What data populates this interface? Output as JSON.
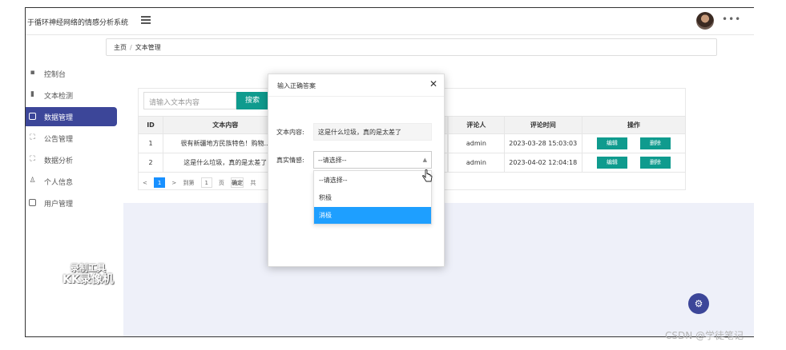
{
  "header": {
    "app_title": "于循环神经网络的情感分析系统",
    "more_label": "•••"
  },
  "sidebar": {
    "items": [
      {
        "label": "控制台",
        "icon": "grid-icon"
      },
      {
        "label": "文本检测",
        "icon": "bar-chart-icon"
      },
      {
        "label": "数据管理",
        "icon": "table-icon"
      },
      {
        "label": "公告管理",
        "icon": "expand-icon"
      },
      {
        "label": "数据分析",
        "icon": "expand-icon"
      },
      {
        "label": "个人信息",
        "icon": "user-icon"
      },
      {
        "label": "用户管理",
        "icon": "document-icon"
      }
    ]
  },
  "breadcrumb": {
    "home": "主页",
    "separator": "/",
    "current": "文本管理"
  },
  "search": {
    "placeholder": "请输入文本内容",
    "button_label": "搜索"
  },
  "table": {
    "headers": [
      "ID",
      "文本内容",
      "评论人",
      "评论时间",
      "操作"
    ],
    "rows": [
      {
        "id": "1",
        "text": "很有新疆地方民族特色！购物...",
        "user": "admin",
        "time": "2023-03-28 15:03:03"
      },
      {
        "id": "2",
        "text": "这是什么垃圾，真的是太差了",
        "user": "admin",
        "time": "2023-04-02 12:04:18"
      }
    ],
    "edit_label": "编辑",
    "delete_label": "删除"
  },
  "pager": {
    "prev": "<",
    "current_page": "1",
    "next": ">",
    "goto_label": "到第",
    "goto_value": "1",
    "page_unit": "页",
    "confirm": "确定",
    "total_prefix": "共"
  },
  "modal": {
    "title": "输入正确答案",
    "close": "✕",
    "text_label": "文本内容:",
    "text_value": "这是什么垃圾，真的是太差了",
    "sentiment_label": "真实情感:",
    "select_value": "--请选择--",
    "options": [
      "--请选择--",
      "积极",
      "消极"
    ],
    "highlighted_option": "消极"
  },
  "watermark": {
    "line1": "录制工具",
    "line2": "KK录像机"
  },
  "footer": {
    "csdn": "CSDN @学徒笔记"
  },
  "colors": {
    "accent": "#3c4699",
    "teal": "#0f9b8e",
    "select_blue": "#1e9fff"
  }
}
